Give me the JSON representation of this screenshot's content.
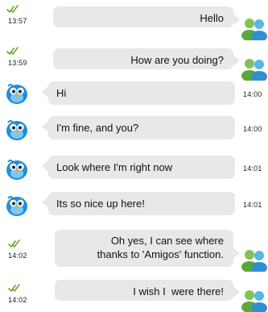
{
  "colors": {
    "bubble": "#e8e8e8",
    "check": "#6aa82a",
    "bird_body": "#1f8fd6"
  },
  "icons": {
    "sent_status": "double-check-icon",
    "contact_avatar": "contact-avatar-icon",
    "buddy_avatar": "buddy-avatar-icon"
  },
  "messages": [
    {
      "direction": "out",
      "text": "Hello",
      "time": "13:57"
    },
    {
      "direction": "out",
      "text": "How are you doing?",
      "time": "13:59"
    },
    {
      "direction": "in",
      "text": "Hi",
      "time": "14:00"
    },
    {
      "direction": "in",
      "text": "I'm fine, and you?",
      "time": "14:00"
    },
    {
      "direction": "in",
      "text": "Look where I'm right now",
      "time": "14:01"
    },
    {
      "direction": "in",
      "text": "Its so nice up here!",
      "time": "14:01"
    },
    {
      "direction": "out",
      "text_line1": "Oh yes, I can see where",
      "text_line2": "thanks to 'Amigos' function.",
      "time": "14:02"
    },
    {
      "direction": "out",
      "text": "I wish I  were there!",
      "time": "14:02"
    }
  ]
}
